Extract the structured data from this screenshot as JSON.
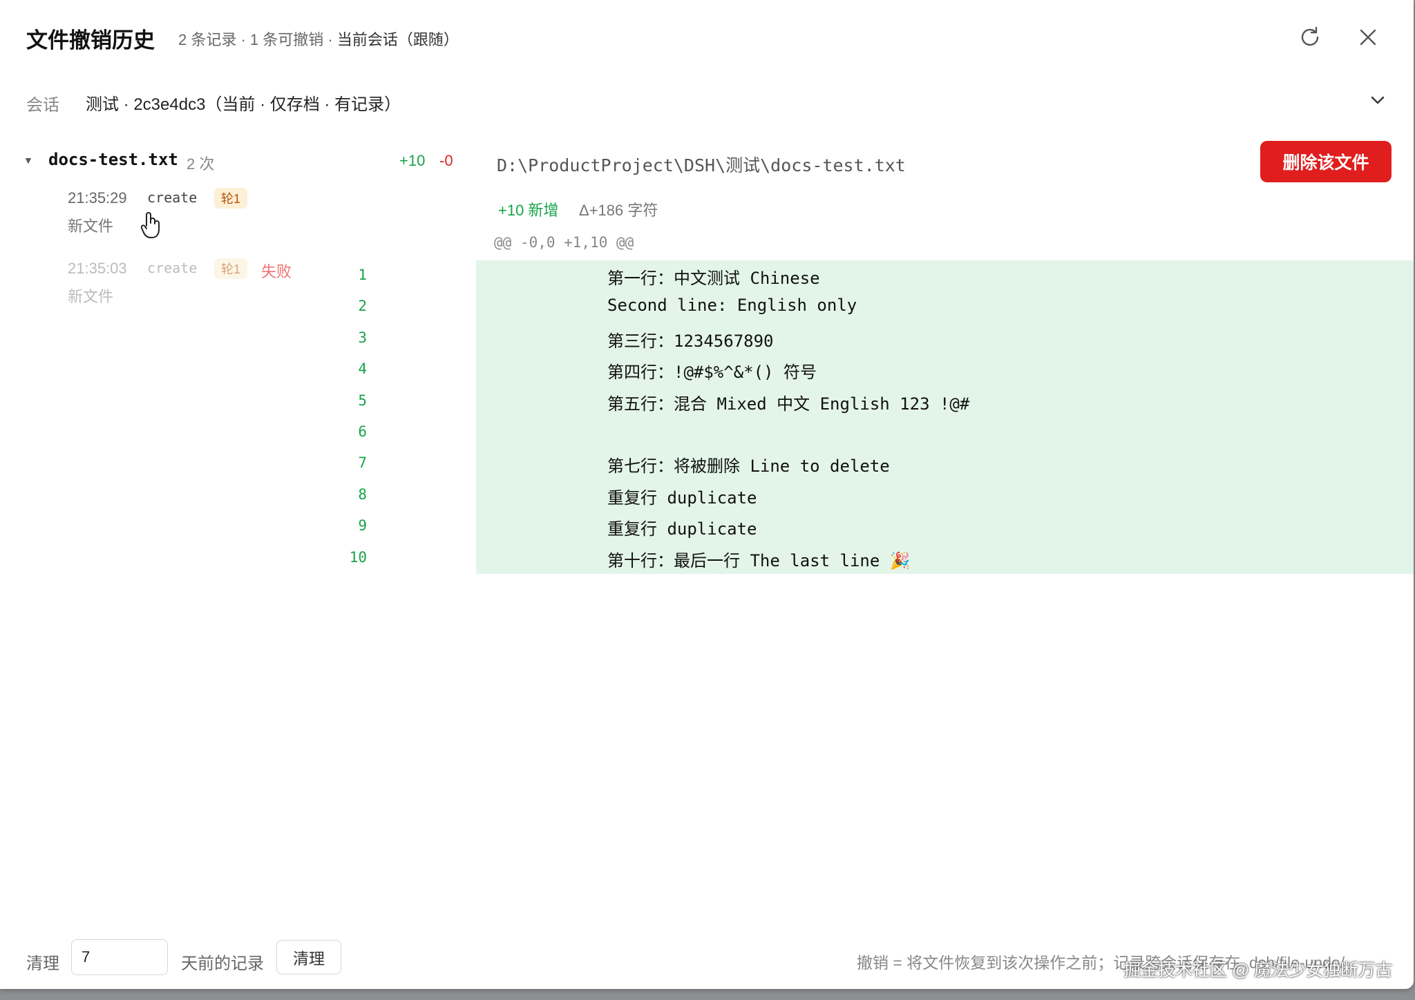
{
  "header": {
    "title": "文件撤销历史",
    "subtitle_main": "2 条记录 · 1 条可撤销 · ",
    "subtitle_current": "当前会话（跟随）"
  },
  "session": {
    "label": "会话",
    "value": "测试 · 2c3e4dc3（当前 · 仅存档 · 有记录）"
  },
  "file": {
    "name": "docs-test.txt",
    "count": "2 次",
    "added": "+10",
    "removed": "-0"
  },
  "entries": [
    {
      "time": "21:35:29",
      "op": "create",
      "badge": "轮1",
      "status": "",
      "desc": "新文件"
    },
    {
      "time": "21:35:03",
      "op": "create",
      "badge": "轮1",
      "status": "失败",
      "desc": "新文件"
    }
  ],
  "detail": {
    "path": "D:\\ProductProject\\DSH\\测试\\docs-test.txt",
    "delete_label": "删除该文件",
    "stat_added": "+10 新增",
    "stat_delta": "Δ+186 字符",
    "hunk": "@@ -0,0 +1,10 @@"
  },
  "diff_lines": [
    {
      "num": "1",
      "text": "第一行：中文测试 Chinese"
    },
    {
      "num": "2",
      "text": "Second line: English only"
    },
    {
      "num": "3",
      "text": "第三行：1234567890"
    },
    {
      "num": "4",
      "text": "第四行：!@#$%^&*() 符号"
    },
    {
      "num": "5",
      "text": "第五行：混合 Mixed 中文 English 123 !@#"
    },
    {
      "num": "6",
      "text": ""
    },
    {
      "num": "7",
      "text": "第七行：将被删除 Line to delete"
    },
    {
      "num": "8",
      "text": "重复行 duplicate"
    },
    {
      "num": "9",
      "text": "重复行 duplicate"
    },
    {
      "num": "10",
      "text": "第十行：最后一行 The last line 🎉"
    }
  ],
  "footer": {
    "clean_label": "清理",
    "days_value": "7",
    "days_suffix": "天前的记录",
    "clean_button": "清理",
    "hint": "撤销 = 将文件恢复到该次操作之前；记录跨会话保存在 .dsh/file-undo/"
  },
  "watermark": "掘金技术社区 @ 魔法少女独断万古",
  "colors": {
    "added": "#16a34a",
    "removed": "#dc2626",
    "diff_bg": "#e3f5e8",
    "danger": "#e01e1e",
    "badge_bg": "#fdf0d5"
  },
  "icons": {
    "refresh": "refresh-icon",
    "close": "close-icon",
    "chevron": "chevron-down-icon",
    "expand": "triangle-down-icon",
    "cursor": "hand-pointer-icon"
  }
}
